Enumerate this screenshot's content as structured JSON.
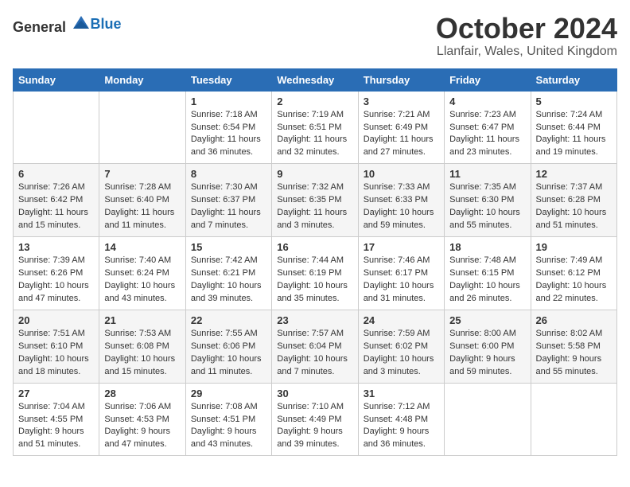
{
  "header": {
    "logo_general": "General",
    "logo_blue": "Blue",
    "month_title": "October 2024",
    "location": "Llanfair, Wales, United Kingdom"
  },
  "days_of_week": [
    "Sunday",
    "Monday",
    "Tuesday",
    "Wednesday",
    "Thursday",
    "Friday",
    "Saturday"
  ],
  "weeks": [
    [
      {
        "date": "",
        "info": ""
      },
      {
        "date": "",
        "info": ""
      },
      {
        "date": "1",
        "info": "Sunrise: 7:18 AM\nSunset: 6:54 PM\nDaylight: 11 hours and 36 minutes."
      },
      {
        "date": "2",
        "info": "Sunrise: 7:19 AM\nSunset: 6:51 PM\nDaylight: 11 hours and 32 minutes."
      },
      {
        "date": "3",
        "info": "Sunrise: 7:21 AM\nSunset: 6:49 PM\nDaylight: 11 hours and 27 minutes."
      },
      {
        "date": "4",
        "info": "Sunrise: 7:23 AM\nSunset: 6:47 PM\nDaylight: 11 hours and 23 minutes."
      },
      {
        "date": "5",
        "info": "Sunrise: 7:24 AM\nSunset: 6:44 PM\nDaylight: 11 hours and 19 minutes."
      }
    ],
    [
      {
        "date": "6",
        "info": "Sunrise: 7:26 AM\nSunset: 6:42 PM\nDaylight: 11 hours and 15 minutes."
      },
      {
        "date": "7",
        "info": "Sunrise: 7:28 AM\nSunset: 6:40 PM\nDaylight: 11 hours and 11 minutes."
      },
      {
        "date": "8",
        "info": "Sunrise: 7:30 AM\nSunset: 6:37 PM\nDaylight: 11 hours and 7 minutes."
      },
      {
        "date": "9",
        "info": "Sunrise: 7:32 AM\nSunset: 6:35 PM\nDaylight: 11 hours and 3 minutes."
      },
      {
        "date": "10",
        "info": "Sunrise: 7:33 AM\nSunset: 6:33 PM\nDaylight: 10 hours and 59 minutes."
      },
      {
        "date": "11",
        "info": "Sunrise: 7:35 AM\nSunset: 6:30 PM\nDaylight: 10 hours and 55 minutes."
      },
      {
        "date": "12",
        "info": "Sunrise: 7:37 AM\nSunset: 6:28 PM\nDaylight: 10 hours and 51 minutes."
      }
    ],
    [
      {
        "date": "13",
        "info": "Sunrise: 7:39 AM\nSunset: 6:26 PM\nDaylight: 10 hours and 47 minutes."
      },
      {
        "date": "14",
        "info": "Sunrise: 7:40 AM\nSunset: 6:24 PM\nDaylight: 10 hours and 43 minutes."
      },
      {
        "date": "15",
        "info": "Sunrise: 7:42 AM\nSunset: 6:21 PM\nDaylight: 10 hours and 39 minutes."
      },
      {
        "date": "16",
        "info": "Sunrise: 7:44 AM\nSunset: 6:19 PM\nDaylight: 10 hours and 35 minutes."
      },
      {
        "date": "17",
        "info": "Sunrise: 7:46 AM\nSunset: 6:17 PM\nDaylight: 10 hours and 31 minutes."
      },
      {
        "date": "18",
        "info": "Sunrise: 7:48 AM\nSunset: 6:15 PM\nDaylight: 10 hours and 26 minutes."
      },
      {
        "date": "19",
        "info": "Sunrise: 7:49 AM\nSunset: 6:12 PM\nDaylight: 10 hours and 22 minutes."
      }
    ],
    [
      {
        "date": "20",
        "info": "Sunrise: 7:51 AM\nSunset: 6:10 PM\nDaylight: 10 hours and 18 minutes."
      },
      {
        "date": "21",
        "info": "Sunrise: 7:53 AM\nSunset: 6:08 PM\nDaylight: 10 hours and 15 minutes."
      },
      {
        "date": "22",
        "info": "Sunrise: 7:55 AM\nSunset: 6:06 PM\nDaylight: 10 hours and 11 minutes."
      },
      {
        "date": "23",
        "info": "Sunrise: 7:57 AM\nSunset: 6:04 PM\nDaylight: 10 hours and 7 minutes."
      },
      {
        "date": "24",
        "info": "Sunrise: 7:59 AM\nSunset: 6:02 PM\nDaylight: 10 hours and 3 minutes."
      },
      {
        "date": "25",
        "info": "Sunrise: 8:00 AM\nSunset: 6:00 PM\nDaylight: 9 hours and 59 minutes."
      },
      {
        "date": "26",
        "info": "Sunrise: 8:02 AM\nSunset: 5:58 PM\nDaylight: 9 hours and 55 minutes."
      }
    ],
    [
      {
        "date": "27",
        "info": "Sunrise: 7:04 AM\nSunset: 4:55 PM\nDaylight: 9 hours and 51 minutes."
      },
      {
        "date": "28",
        "info": "Sunrise: 7:06 AM\nSunset: 4:53 PM\nDaylight: 9 hours and 47 minutes."
      },
      {
        "date": "29",
        "info": "Sunrise: 7:08 AM\nSunset: 4:51 PM\nDaylight: 9 hours and 43 minutes."
      },
      {
        "date": "30",
        "info": "Sunrise: 7:10 AM\nSunset: 4:49 PM\nDaylight: 9 hours and 39 minutes."
      },
      {
        "date": "31",
        "info": "Sunrise: 7:12 AM\nSunset: 4:48 PM\nDaylight: 9 hours and 36 minutes."
      },
      {
        "date": "",
        "info": ""
      },
      {
        "date": "",
        "info": ""
      }
    ]
  ]
}
